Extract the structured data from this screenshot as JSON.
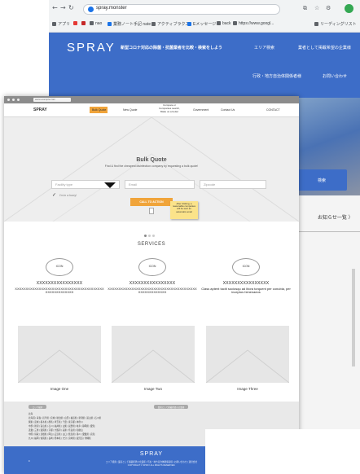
{
  "bg_browser": {
    "nav_buttons": [
      "←",
      "→",
      "↻"
    ],
    "url": "spray.monster",
    "toolbar_icons": [
      "⧉",
      "☆",
      "⚙"
    ],
    "bookmarks": [
      {
        "label": "アプリ",
        "color": "#5f6368"
      },
      {
        "label": "",
        "color": "#e53935"
      },
      {
        "label": "",
        "color": "#c62828"
      },
      {
        "label": "nao",
        "color": "#5f6368"
      },
      {
        "label": "業務ノート手記 nate",
        "color": "#1a73e8"
      },
      {
        "label": "アクティブラクス",
        "color": "#5f6368"
      },
      {
        "label": "Eメッセージ",
        "color": "#1a73e8"
      },
      {
        "label": "back",
        "color": "#5f6368"
      },
      {
        "label": "https://www.googl...",
        "color": "#5f6368"
      },
      {
        "label": "リーディングリスト",
        "color": "#5f6368"
      }
    ],
    "site": {
      "logo": "SPRAY",
      "tagline": "新型コロナ対応の除菌・抗菌業者を比較・検索をしよう",
      "menu_top": [
        "エリア検索",
        "業者として掲載希望の企業様"
      ],
      "menu_bottom": [
        "行政・地方自治体関係者様",
        "お問い合わせ"
      ],
      "hero_button": "検索",
      "news_link": "お知らせ一覧 〉"
    }
  },
  "wireframe": {
    "url": "www.example.com",
    "logo": "SPRAY",
    "nav": {
      "bulk_quote": "Bulk Quote",
      "new_quote": "New Quote",
      "multi": "Compare or Companies search, Make us a better",
      "government": "Government",
      "contact_us": "Contact Us",
      "contact": "CONTACT"
    },
    "hero": {
      "title": "Bulk Quote",
      "subtitle": "Find & find the cheapest disinfection company by requesting a bulk quote!",
      "facility_placeholder": "Facility type",
      "email_placeholder": "Email",
      "zipcode_placeholder": "Zipcode",
      "checkbox_label": "I'm in a hurry!",
      "cta": "CALL TO ACTION",
      "note": "After clicking, a reasonable companies will be sent an automatic email"
    },
    "services": {
      "title": "SERVICES",
      "items": [
        {
          "icon": "ICON",
          "heading": "XXXXXXXXXXXXXXXX",
          "body": "XXXXXXXXXXXXXXXXXXXXXXXXXXXXXXXXXXXXXXXXXXXXXXXXXXXXXX"
        },
        {
          "icon": "ICON",
          "heading": "XXXXXXXXXXXXXXXX",
          "body": "XXXXXXXXXXXXXXXXXXXXXXXXXXXXXXXXXXXXXXXXXXXXXXXXXXXXXX"
        },
        {
          "icon": "ICON",
          "heading": "XXXXXXXXXXXXXXXX",
          "body": "Class aptent taciti sociosqu ad litora torquent per conubia, per inceptos himenaeos"
        }
      ]
    },
    "images": [
      {
        "label": "Image One"
      },
      {
        "label": "Image Two"
      },
      {
        "label": "Image Three"
      }
    ],
    "footer": {
      "pill_left": "エリア検索",
      "pill_right": "業者として掲載希望の企業様",
      "lines": [
        "北海",
        "北海道 | 青森 | 岩手県 | 宮城 | 秋田県 | 山形 | 福島県 | 新潟県 | 富山県 | 石川県",
        "関東 | 茨城 | 栃木県 | 群馬 | 埼玉県 | 千葉 | 東京都 | 神奈川",
        "中部 | 新潟 | 富山県 | 石川 | 福井県 | 山梨 | 長野県 | 岐阜 | 静岡県 | 愛知",
        "近畿 | 三重 | 滋賀県 | 京都 | 大阪府 | 兵庫 | 奈良県 | 和歌山",
        "中国 | 鳥取 | 島根県 | 岡山 | 広島県 | 山口 | 徳島県 | 香川 | 愛媛県 | 高知",
        "九州 | 福岡 | 佐賀県 | 長崎 | 熊本県 | 大分 | 宮崎県 | 鹿児島 | 沖縄県"
      ],
      "bottom_logo": "SPRAY",
      "bottom_line1": "エリア検索 | 業者として掲載希望の企業様 | 行政・地方自治体関係者様 | お問い合わせ | 運営会社",
      "bottom_line2": "COPYRIGHT © SPRAY ALL RIGHTS RESERVED.",
      "bottom_mark": "≡"
    }
  }
}
